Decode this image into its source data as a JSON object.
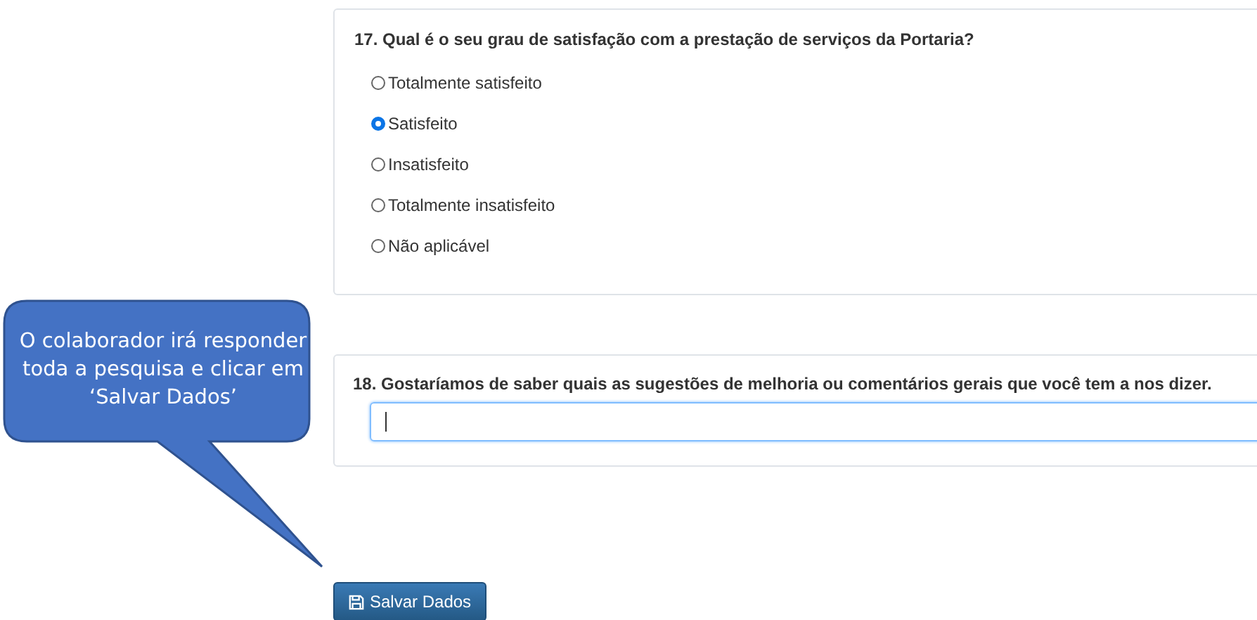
{
  "questions": [
    {
      "kind": "radio",
      "title": "17. Qual é o seu grau de satisfação com a prestação de serviços da Portaria?",
      "options": [
        {
          "label": "Totalmente satisfeito",
          "selected": false
        },
        {
          "label": "Satisfeito",
          "selected": true
        },
        {
          "label": "Insatisfeito",
          "selected": false
        },
        {
          "label": "Totalmente insatisfeito",
          "selected": false
        },
        {
          "label": "Não aplicável",
          "selected": false
        }
      ]
    },
    {
      "kind": "text",
      "title": "18. Gostaríamos de saber quais as sugestões de melhoria ou comentários gerais que você tem a nos dizer."
    }
  ],
  "save_button": "Salvar Dados",
  "callout": {
    "text": "O colaborador irá responder toda a pesquisa e clicar em ‘Salvar Dados’"
  }
}
